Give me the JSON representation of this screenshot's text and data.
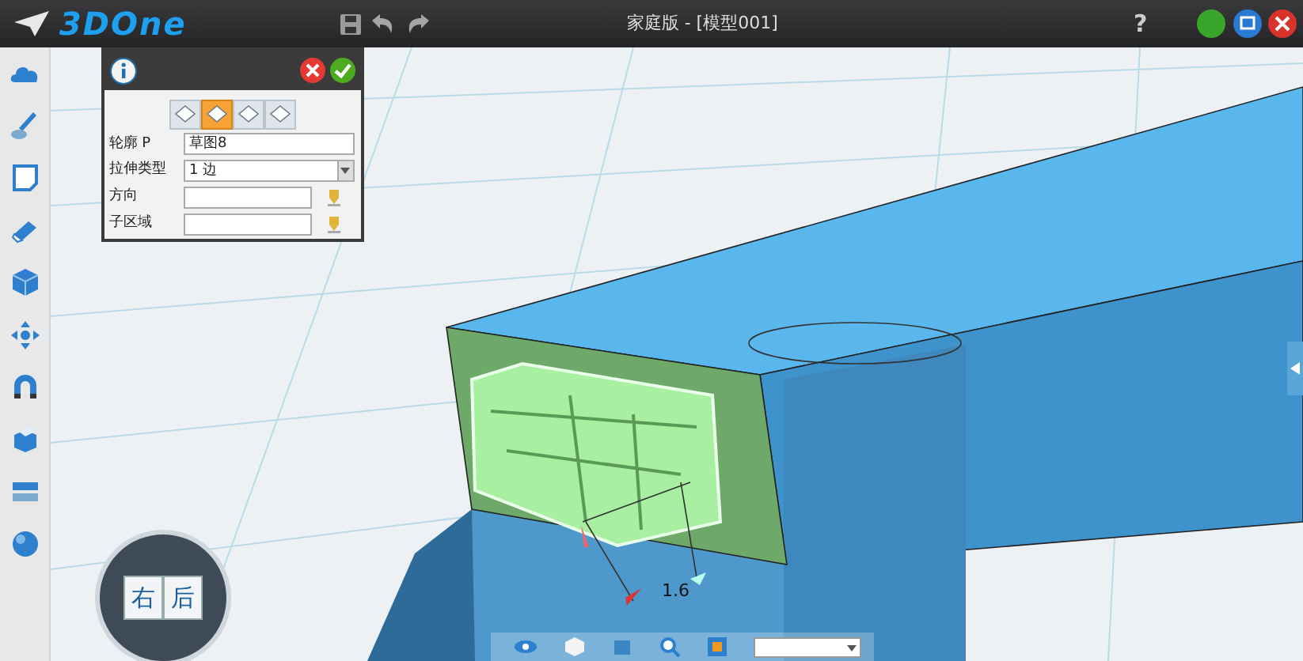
{
  "app": {
    "logo": "3DOne",
    "title": "家庭版 - [模型001]",
    "help": "?"
  },
  "dialog": {
    "modes": [
      {
        "selected": false
      },
      {
        "selected": true
      },
      {
        "selected": false
      },
      {
        "selected": false
      }
    ],
    "fields": [
      {
        "kind": "text",
        "label": "轮廓 P",
        "value": "草图8"
      },
      {
        "kind": "select",
        "label": "拉伸类型",
        "value": "1 边"
      },
      {
        "kind": "pick",
        "label": "方向"
      },
      {
        "kind": "pick",
        "label": "子区域"
      }
    ]
  },
  "viewport": {
    "view_cube": [
      "右",
      "后"
    ],
    "dimension": "1.6"
  }
}
